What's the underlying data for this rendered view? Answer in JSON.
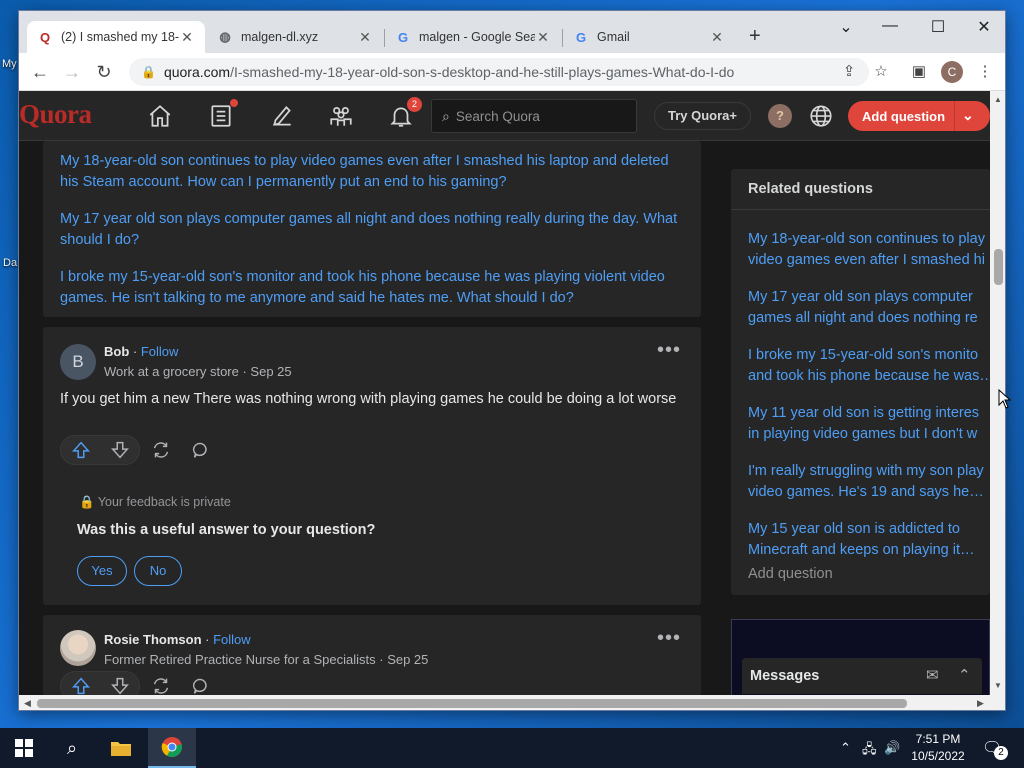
{
  "desktop": {
    "icons": [
      "My",
      "Da"
    ]
  },
  "browser": {
    "tabs": [
      {
        "title": "(2) I smashed my 18-",
        "favicon": "quora-icon",
        "active": true
      },
      {
        "title": "malgen-dl.xyz",
        "favicon": "globe-icon",
        "active": false
      },
      {
        "title": "malgen - Google Sea",
        "favicon": "google-icon",
        "active": false
      },
      {
        "title": "Gmail",
        "favicon": "google-icon",
        "active": false
      }
    ],
    "new_tab": "+",
    "url_host": "quora.com",
    "url_path": "/I-smashed-my-18-year-old-son-s-desktop-and-he-still-plays-games-What-do-I-do",
    "profile_initial": "C"
  },
  "quora": {
    "logo": "Quora",
    "notification_count": "2",
    "search_placeholder": "Search Quora",
    "try_plus": "Try Quora+",
    "help": "?",
    "add_question": "Add question"
  },
  "related_inline": [
    "My 18-year-old son continues to play video games even after I smashed his laptop and deleted his Steam account. How can I permanently put an end to his gaming?",
    "My 17 year old son plays computer games all night and does nothing really during the day. What should I do?",
    "I broke my 15-year-old son's monitor and took his phone because he was playing violent video games. He isn't talking to me anymore and said he hates me. What should I do?"
  ],
  "answer1": {
    "avatar_initial": "B",
    "author": "Bob",
    "follow": "Follow",
    "credential": "Work at a grocery store · Sep 25",
    "text": "If you get him a new There was nothing wrong with playing games he could be doing a lot worse",
    "feedback_note": "Your feedback is private",
    "feedback_question": "Was this a useful answer to your question?",
    "yes": "Yes",
    "no": "No"
  },
  "answer2": {
    "author": "Rosie Thomson",
    "follow": "Follow",
    "credential": "Former Retired Practice Nurse for a Specialists · Sep 25"
  },
  "sidebar": {
    "title": "Related questions",
    "items": [
      [
        "My 18-year-old son continues to play",
        "video games even after I smashed hi"
      ],
      [
        "My 17 year old son plays computer",
        "games all night and does nothing re"
      ],
      [
        "I broke my 15-year-old son's monito",
        "and took his phone because he was…"
      ],
      [
        "My 11 year old son is getting interes",
        "in playing video games but I don't w"
      ],
      [
        "I'm really struggling with my son play",
        "video games. He's 19 and says he…"
      ],
      [
        "My 15 year old son is addicted to",
        "Minecraft and keeps on playing it…"
      ]
    ],
    "add_question": "Add question",
    "messages": "Messages"
  },
  "taskbar": {
    "time": "7:51 PM",
    "date": "10/5/2022",
    "notifications": "2"
  }
}
